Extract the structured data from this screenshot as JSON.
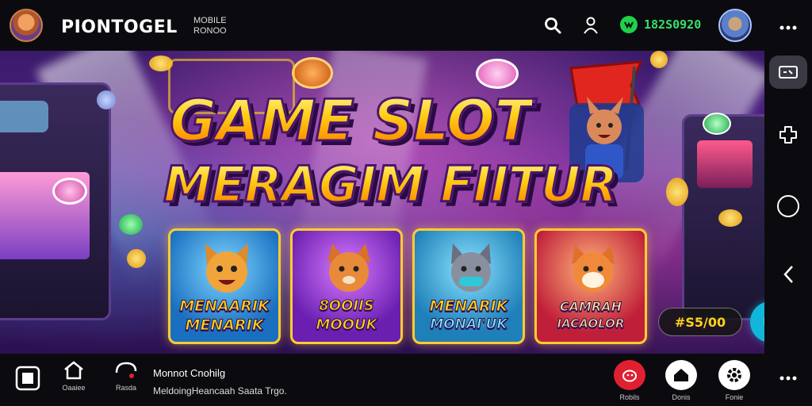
{
  "header": {
    "brand": "PIONTOGEL",
    "brand_sub_line1": "MOBILE",
    "brand_sub_line2": "RONOO",
    "balance": "182S0920",
    "icons": [
      "search-icon",
      "user-icon",
      "wallet-icon",
      "avatar"
    ]
  },
  "hero": {
    "title_line1": "GAME SLOT",
    "title_line2": "MERAGIM FIITUR",
    "cards": [
      {
        "line1": "MENAARIK",
        "line2": "MENARIK",
        "bg": "#1a6fc0"
      },
      {
        "line1": "8OOIIS",
        "line2": "MOOUK",
        "bg": "#6a1fb0"
      },
      {
        "line1": "MENARIK",
        "line2": "MONAI'UK",
        "bg": "#1f7fb8"
      },
      {
        "line1": "CAMRAH",
        "line2": "IACAOLOR",
        "bg": "#c01f3a"
      }
    ],
    "promo_amount": "#S5/00",
    "colors": {
      "accent": "#ffd21a",
      "balance": "#35e06a",
      "chat": "#12b6d8"
    }
  },
  "sidebar": {
    "items": [
      "menu-dots-icon",
      "cash-icon",
      "puzzle-icon",
      "circle-icon",
      "back-arrow-icon",
      "menu-dots-icon"
    ]
  },
  "bottom": {
    "nav_left": [
      {
        "label": "",
        "icon": "square-icon"
      },
      {
        "label": "Oaaiee",
        "icon": "home-icon"
      },
      {
        "label": "Rasda",
        "icon": "chat-icon"
      }
    ],
    "notice_title": "Monnot Cnohilg",
    "notice_text": "MeldoingHeancaah Saata Trgo.",
    "nav_right": [
      {
        "label": "Robils",
        "icon": "piggy-icon"
      },
      {
        "label": "Donis",
        "icon": "home-icon"
      },
      {
        "label": "Fonie",
        "icon": "gear-icon"
      }
    ]
  }
}
